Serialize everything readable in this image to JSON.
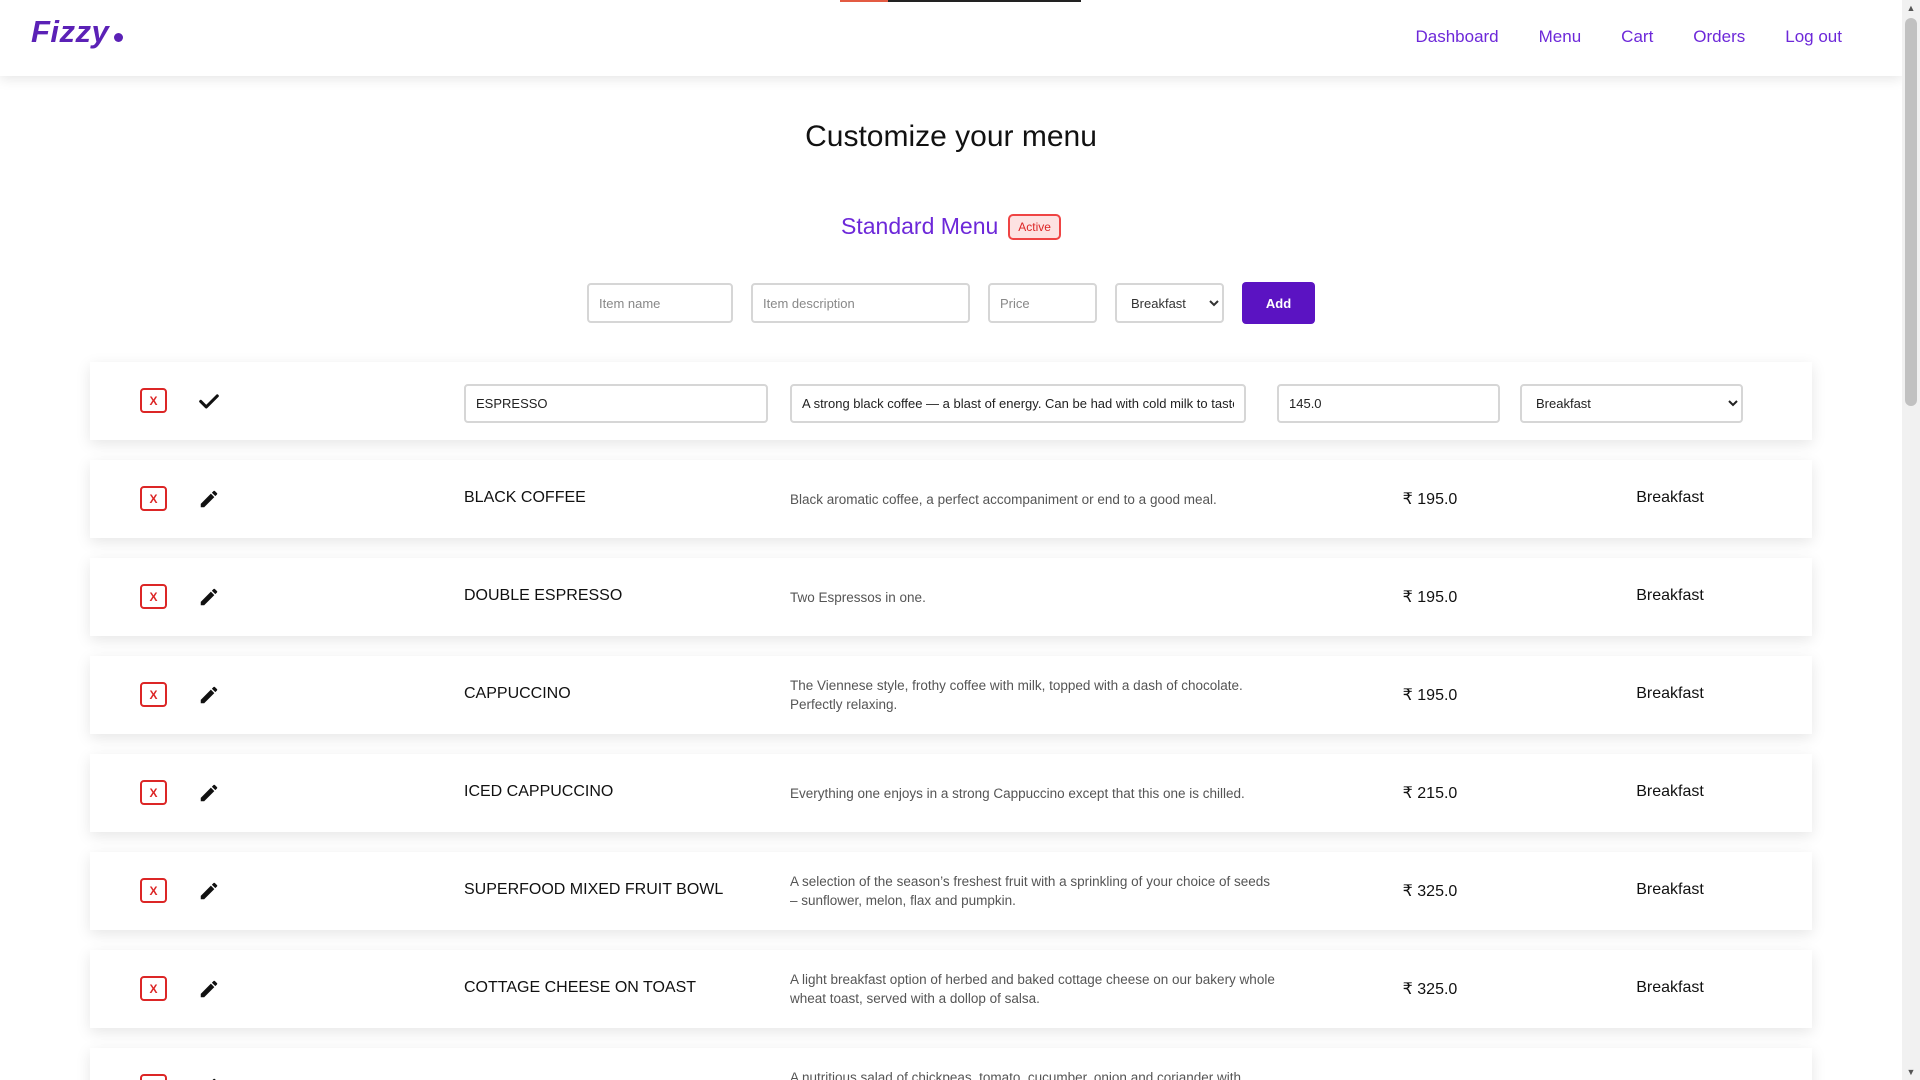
{
  "header": {
    "logo": "Fizzy",
    "nav": [
      "Dashboard",
      "Menu",
      "Cart",
      "Orders",
      "Log out"
    ],
    "loading_progress": 0.2
  },
  "page": {
    "title": "Customize your menu",
    "menu_name": "Standard Menu",
    "status_badge": "Active"
  },
  "add_form": {
    "name_placeholder": "Item name",
    "description_placeholder": "Item description",
    "price_placeholder": "Price",
    "category_selected": "Breakfast",
    "add_label": "Add"
  },
  "editing_row": {
    "delete_label": "X",
    "name_value": "ESPRESSO",
    "description_value": "A strong black coffee — a blast of energy. Can be had with cold milk to taste.",
    "price_value": "145.0",
    "category_selected": "Breakfast"
  },
  "items": [
    {
      "delete_label": "X",
      "name": "BLACK COFFEE",
      "description": "Black aromatic coffee, a perfect accompaniment or end to a good meal.",
      "price": "₹ 195.0",
      "category": "Breakfast"
    },
    {
      "delete_label": "X",
      "name": "DOUBLE ESPRESSO",
      "description": "Two Espressos in one.",
      "price": "₹ 195.0",
      "category": "Breakfast"
    },
    {
      "delete_label": "X",
      "name": "CAPPUCCINO",
      "description": "The Viennese style, frothy coffee with milk, topped with a dash of chocolate. Perfectly relaxing.",
      "price": "₹ 195.0",
      "category": "Breakfast"
    },
    {
      "delete_label": "X",
      "name": "ICED CAPPUCCINO",
      "description": "Everything one enjoys in a strong Cappuccino except that this one is chilled.",
      "price": "₹ 215.0",
      "category": "Breakfast"
    },
    {
      "delete_label": "X",
      "name": "SUPERFOOD MIXED FRUIT BOWL",
      "description": "A selection of the season’s freshest fruit with a sprinkling of your choice of seeds – sunflower, melon, flax and pumpkin.",
      "price": "₹ 325.0",
      "category": "Breakfast"
    },
    {
      "delete_label": "X",
      "name": "COTTAGE CHEESE ON TOAST",
      "description": "A light breakfast option of herbed and baked cottage cheese on our bakery whole wheat toast, served with a dollop of salsa.",
      "price": "₹ 325.0",
      "category": "Breakfast"
    },
    {
      "delete_label": "X",
      "name": "",
      "description": "A nutritious salad of chickpeas, tomato, cucumber, onion and coriander with",
      "price": "",
      "category": ""
    }
  ],
  "colors": {
    "brand": "#5b21b6",
    "nav_link": "#6d28d9",
    "add_button": "#5b13c2",
    "danger": "#dc2626"
  }
}
